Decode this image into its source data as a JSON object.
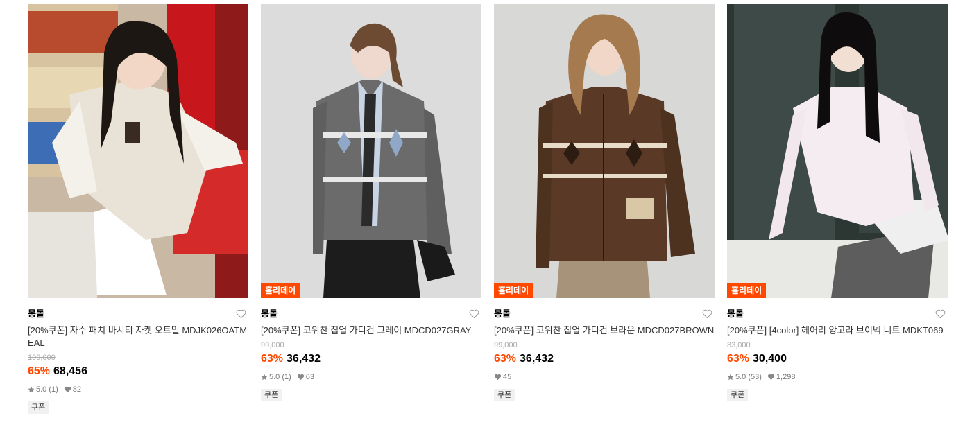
{
  "colors": {
    "accent": "#ff4800",
    "badge_bg": "#f1f1f1"
  },
  "products": [
    {
      "badge": "",
      "brand": "몽돌",
      "title": "[20%쿠폰] 자수 패치 바시티 자켓 오트밀 MDJK026OATMEAL",
      "original_price": "199,000",
      "discount_rate": "65%",
      "sale_price": "68,456",
      "rating": "5.0 (1)",
      "likes": "82",
      "tag": "쿠폰"
    },
    {
      "badge": "홀리데이",
      "brand": "몽돌",
      "title": "[20%쿠폰] 코위찬 집업 가디건 그레이 MDCD027GRAY",
      "original_price": "99,000",
      "discount_rate": "63%",
      "sale_price": "36,432",
      "rating": "5.0 (1)",
      "likes": "63",
      "tag": "쿠폰"
    },
    {
      "badge": "홀리데이",
      "brand": "몽돌",
      "title": "[20%쿠폰] 코위찬 집업 가디건 브라운 MDCD027BROWN",
      "original_price": "99,000",
      "discount_rate": "63%",
      "sale_price": "36,432",
      "rating": "",
      "likes": "45",
      "tag": "쿠폰"
    },
    {
      "badge": "홀리데이",
      "brand": "몽돌",
      "title": "[20%쿠폰] [4color] 헤어리 앙고라 브이넥 니트 MDKT069",
      "original_price": "83,000",
      "discount_rate": "63%",
      "sale_price": "30,400",
      "rating": "5.0 (53)",
      "likes": "1,298",
      "tag": "쿠폰"
    }
  ]
}
